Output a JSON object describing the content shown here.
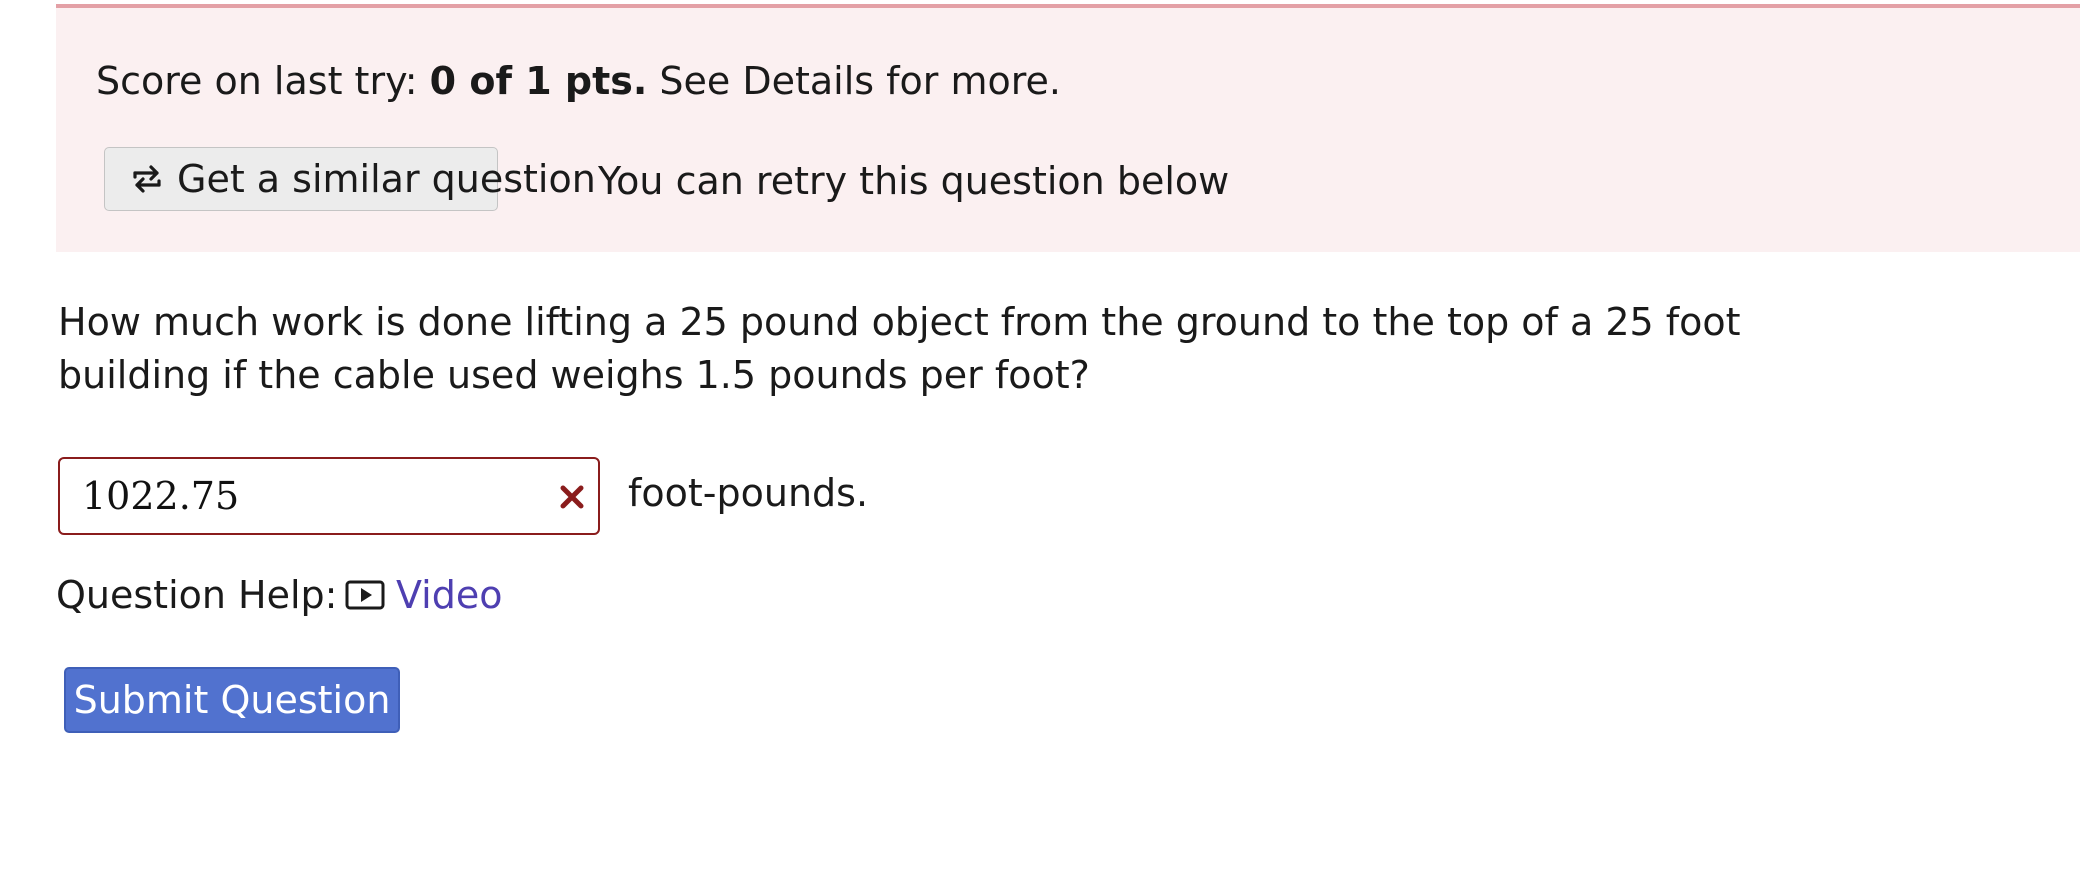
{
  "score_banner": {
    "prefix": "Score on last try: ",
    "score": "0 of 1 pts.",
    "suffix": " See Details for more.",
    "similar_button_label": "Get a similar question",
    "similar_button_icon": "retry-arrows-icon",
    "retry_text": "You can retry this question below",
    "background_color": "#fbf0f1",
    "border_color": "#e3a0a6"
  },
  "question": {
    "text": "How much work is done lifting a 25 pound object from the ground to the top of a 25 foot building if the cable used weighs 1.5 pounds per foot?",
    "answer_value": "1022.75",
    "answer_status": "incorrect",
    "answer_status_icon": "x-mark-icon",
    "unit_text": "foot-pounds."
  },
  "help": {
    "label": "Question Help:",
    "video_label": "Video",
    "video_icon": "video-play-icon",
    "link_color": "#4e3fb1"
  },
  "submit": {
    "label": "Submit Question",
    "color": "#5172cf"
  }
}
